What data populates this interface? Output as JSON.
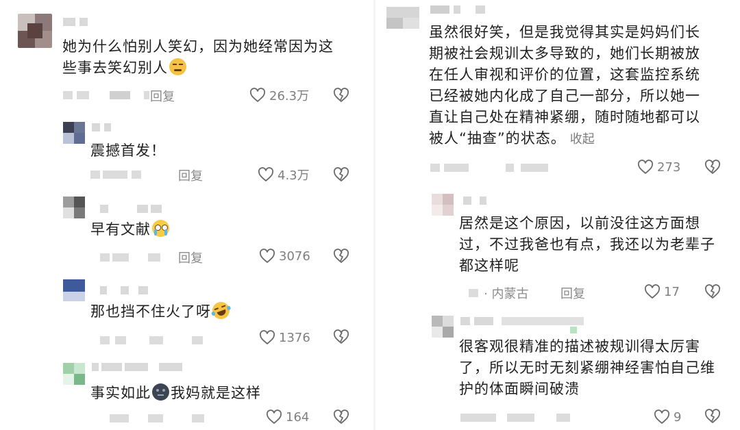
{
  "left": {
    "comments": [
      {
        "text_lines": [
          "她为什么怕别人笑幻，因为她经常因为这",
          "些事去笑幻别人"
        ],
        "emoji": "smirking-face-emoji",
        "reply": "回复",
        "likes": "26.3万"
      },
      {
        "text_lines": [
          "震撼首发！"
        ],
        "reply": "回复",
        "likes": "4.3万"
      },
      {
        "text_lines": [
          "早有文献"
        ],
        "emoji": "pleading-tears-emoji",
        "reply": "回复",
        "likes": "3076"
      },
      {
        "text_lines": [
          "那也挡不住火了呀"
        ],
        "emoji": "laughing-tears-emoji",
        "likes": "1376"
      },
      {
        "text_lines": [
          "事实如此",
          "我妈就是这样"
        ],
        "emoji": "dark-face-emoji",
        "likes": "164"
      }
    ]
  },
  "right": {
    "comments": [
      {
        "text_lines": [
          "虽然很好笑，但是我觉得其实是妈妈们长",
          "期被社会规训太多导致的，她们长期被放",
          "在任人审视和评价的位置，这套监控系统",
          "已经被她内化成了自己一部分，所以她一",
          "直让自己处在精神紧绷，随时随地都可以",
          "被人“抽查”的状态。"
        ],
        "collapse": "收起",
        "likes": "273"
      },
      {
        "text_lines": [
          "居然是这个原因，以前没往这方面想",
          "过，不过我爸也有点，我还以为老辈子",
          "都这样呢"
        ],
        "location": "· 内蒙古",
        "reply": "回复",
        "likes": "17"
      },
      {
        "text_lines": [
          "很客观很精准的描述被规训得太厉害",
          "了，所以无时无刻紧绷神经害怕自己维",
          "护的体面瞬间破溃"
        ],
        "likes": "9"
      }
    ]
  },
  "colors": {
    "text": "#1f1f1f",
    "meta": "#8a8a8a",
    "blur": "#d9d9d9",
    "icon": "#6a6a6a"
  }
}
